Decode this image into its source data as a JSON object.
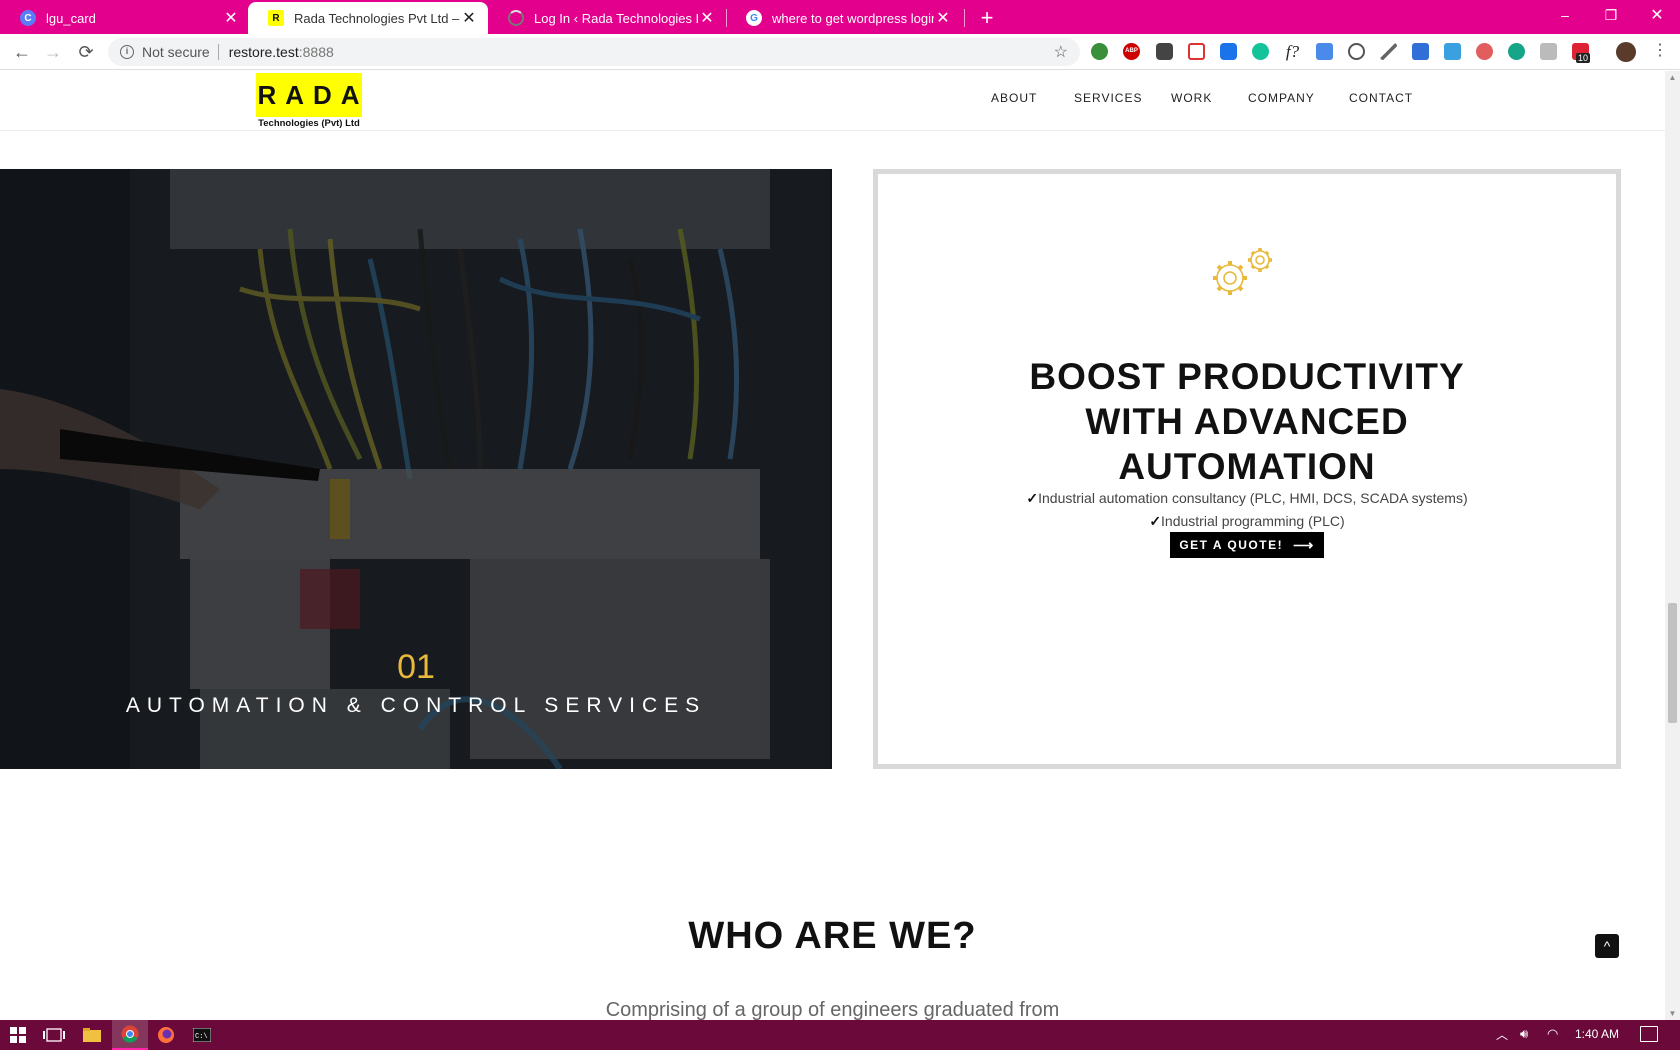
{
  "browser": {
    "tabs": [
      {
        "title": "lgu_card",
        "favicon": "c-circle-icon",
        "active": false
      },
      {
        "title": "Rada Technologies Pvt Ltd – Autc",
        "favicon": "rada-r-icon",
        "active": true
      },
      {
        "title": "Log In ‹ Rada Technologies Pvt Lt",
        "favicon": "loading-icon",
        "active": false
      },
      {
        "title": "where to get wordpress login pa",
        "favicon": "google-g-icon",
        "active": false
      }
    ],
    "new_tab": "+",
    "window_controls": {
      "minimize": "–",
      "restore": "❐",
      "close": "✕"
    },
    "nav": {
      "back": "←",
      "forward": "→",
      "reload": "⟳"
    },
    "omnibox": {
      "security": "Not secure",
      "host": "restore.test",
      "port": ":8888"
    },
    "extensions": [
      "bookmark-ext-icon",
      "abp-icon",
      "ghostery-icon",
      "gmail-icon",
      "pocket-icon",
      "grammarly-icon",
      "fx-icon",
      "translate-icon",
      "wordpress-icon",
      "eyedropper-icon",
      "pocket-save-icon",
      "screenshot-icon",
      "shield-ext-icon",
      "mercury-icon",
      "ext-k-icon",
      "calendar-badge-icon",
      "profile-avatar"
    ],
    "extension_badge": "10"
  },
  "site": {
    "logo_text": "RADA",
    "logo_sub": "Technologies (Pvt) Ltd",
    "menu": [
      "ABOUT",
      "SERVICES",
      "WORK",
      "COMPANY",
      "CONTACT"
    ],
    "service_number": "01",
    "service_title": "AUTOMATION & CONTROL SERVICES",
    "card": {
      "heading": "BOOST PRODUCTIVITY WITH ADVANCED AUTOMATION",
      "heading_lines": [
        "BOOST PRODUCTIVITY",
        "WITH ADVANCED",
        "AUTOMATION"
      ],
      "bullets": [
        "Industrial automation consultancy (PLC, HMI, DCS, SCADA systems)",
        "Industrial programming (PLC)"
      ],
      "check": "✓",
      "cta": "GET A QUOTE!",
      "cta_arrow": "⟶"
    },
    "who_title": "WHO ARE WE?",
    "who_text": "Comprising of a group of engineers graduated from",
    "to_top": "^"
  },
  "taskbar": {
    "clock": "1:40 AM",
    "items": [
      "start-icon",
      "task-view-icon",
      "file-explorer-icon",
      "chrome-icon",
      "firefox-icon",
      "cmd-icon"
    ]
  },
  "colors": {
    "tab_strip": "#e3008c",
    "accent_gold": "#e8b93a",
    "logo_yellow": "#ffff00",
    "taskbar": "#6b0a3a"
  }
}
